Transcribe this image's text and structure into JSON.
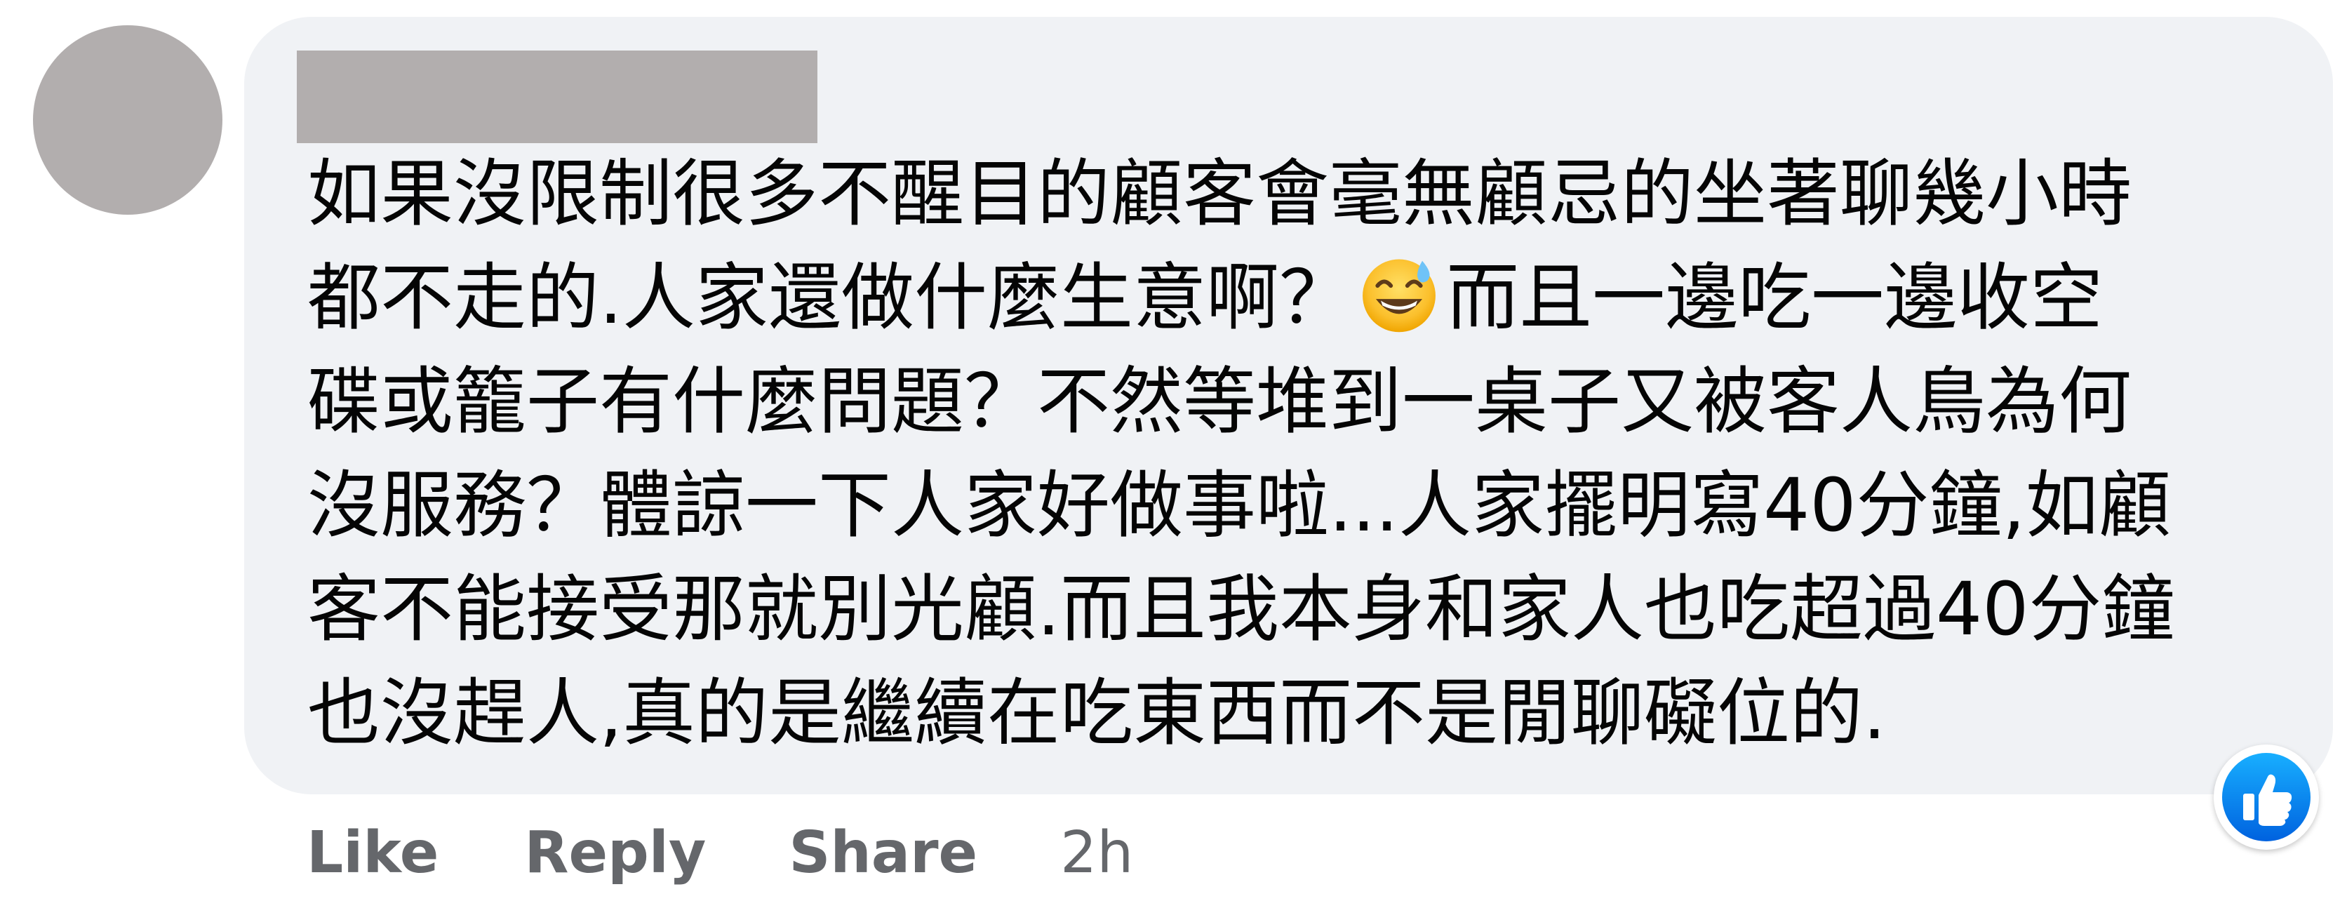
{
  "comment": {
    "text_lines": [
      "如果沒限制很多不醒目的顧客會毫無顧忌的坐著聊幾小時",
      [
        "都不走的.人家還做什麼生意啊？",
        "而且一邊吃一邊收空"
      ],
      "碟或籠子有什麼問題？不然等堆到一桌子又被客人鳥為何",
      "沒服務？體諒一下人家好做事啦...人家擺明寫40分鐘,如顧",
      "客不能接受那就別光顧.而且我本身和家人也吃超過40分鐘",
      "也沒趕人,真的是繼續在吃東西而不是閒聊礙位的."
    ],
    "emoji_icon": "grinning-face-with-sweat-emoji",
    "reaction_icon": "thumbs-up-icon",
    "colors": {
      "bubble": "#f0f2f5",
      "text": "#050505",
      "meta": "#65676b",
      "redacted": "#b2aeae",
      "like_blue": "#0866ff"
    }
  },
  "actions": {
    "like_label": "Like",
    "reply_label": "Reply",
    "share_label": "Share",
    "timestamp": "2h"
  }
}
